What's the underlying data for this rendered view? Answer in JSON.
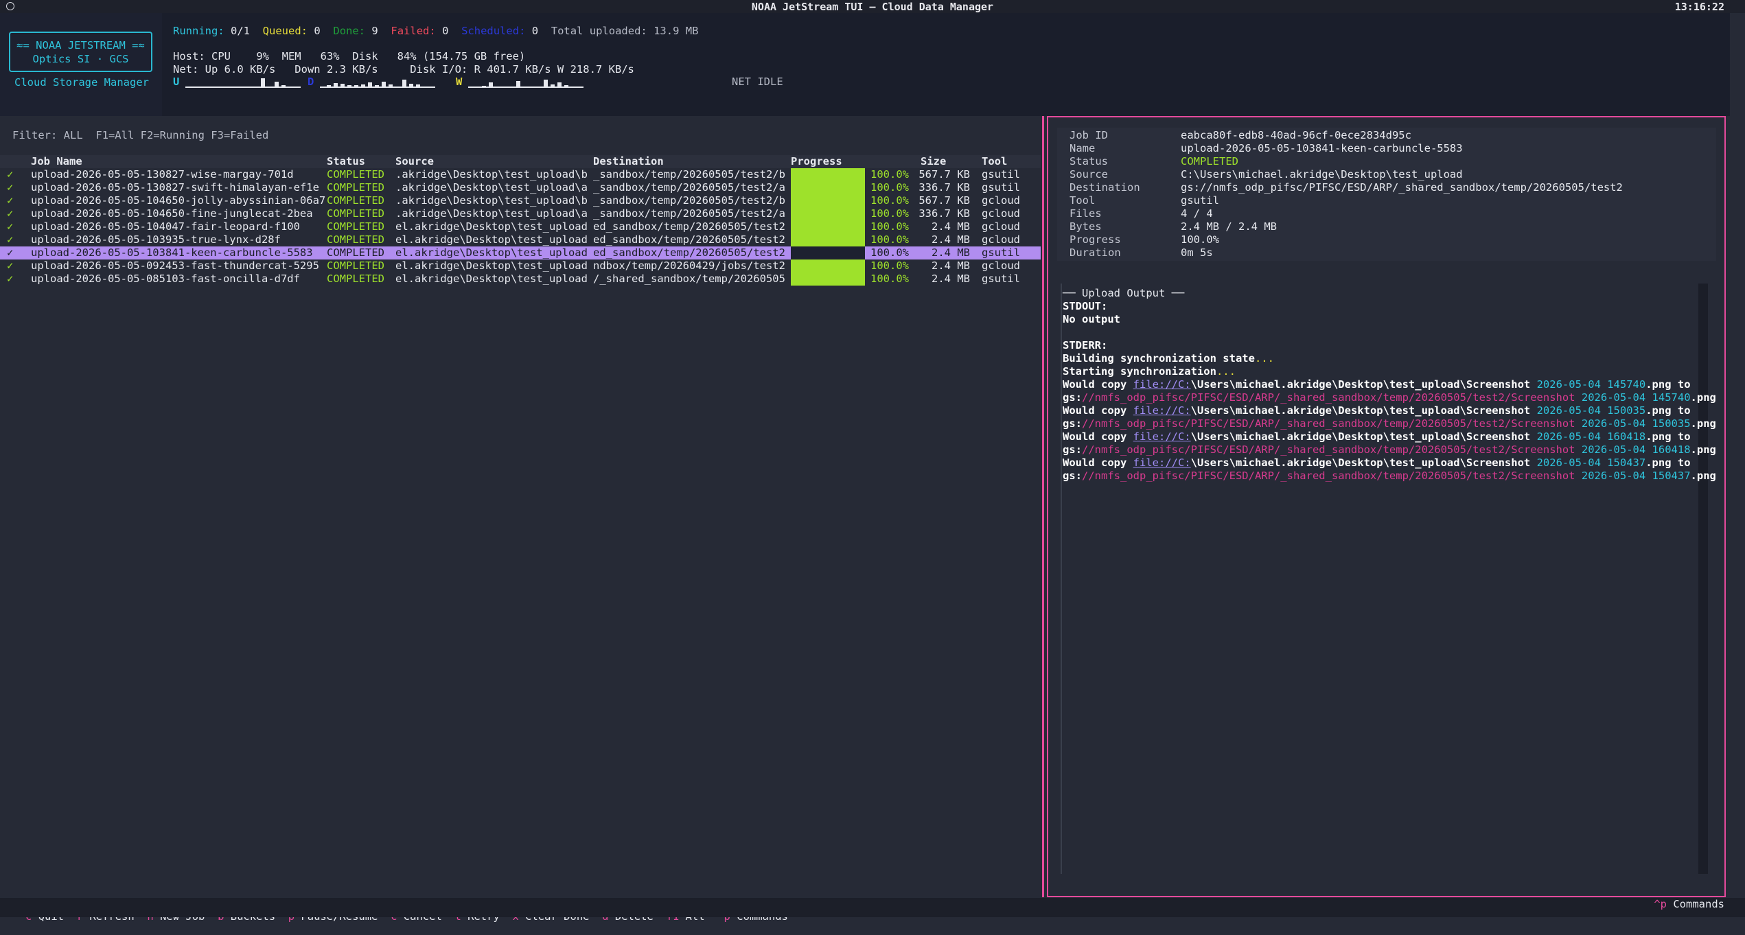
{
  "titlebar": {
    "title": "NOAA JetStream TUI — Cloud Data Manager",
    "clock": "13:16:22"
  },
  "logo": {
    "line1": "≈= NOAA JETSTREAM =≈",
    "line2": "Optics SI · GCS",
    "subtitle": "Cloud Storage Manager"
  },
  "stats": {
    "running_label": "Running:",
    "running_value": "0/1",
    "queued_label": "Queued:",
    "queued_value": "0",
    "done_label": "Done:",
    "done_value": "9",
    "failed_label": "Failed:",
    "failed_value": "0",
    "scheduled_label": "Scheduled:",
    "scheduled_value": "0",
    "total_uploaded": "Total uploaded: 13.9 MB",
    "host_line": "Host: CPU    9%  MEM   63%  Disk   84% (154.75 GB free)",
    "net_line": "Net: Up 6.0 KB/s   Down 2.3 KB/s     Disk I/O: R 401.7 KB/s W 218.7 KB/s",
    "spark_up_label": "U",
    "spark_down_label": "D",
    "spark_w_label": "W",
    "net_idle": "NET IDLE",
    "spark_up": [
      0,
      0,
      0,
      0,
      0,
      0,
      0,
      0,
      0,
      0,
      0,
      14,
      0,
      9,
      4,
      0,
      0
    ],
    "spark_down": [
      0,
      4,
      7,
      6,
      4,
      4,
      5,
      8,
      4,
      9,
      5,
      0,
      12,
      6,
      5,
      0,
      0
    ],
    "spark_w": [
      0,
      0,
      3,
      8,
      0,
      0,
      0,
      10,
      0,
      0,
      0,
      12,
      5,
      8,
      4,
      0,
      0
    ],
    "colors": {
      "cyan": "#2fc4dc",
      "blue": "#2b39d8",
      "yellow": "#e7dd3a"
    }
  },
  "filter": {
    "text": "Filter: ALL  F1=All F2=Running F3=Failed"
  },
  "table": {
    "headers": {
      "name": "Job Name",
      "status": "Status",
      "source": "Source",
      "destination": "Destination",
      "progress": "Progress",
      "size": "Size",
      "tool": "Tool"
    },
    "rows": [
      {
        "check": "✓",
        "name": "upload-2026-05-05-130827-wise-margay-701d",
        "status": "COMPLETED",
        "source": ".akridge\\Desktop\\test_upload\\b",
        "destination": "_sandbox/temp/20260505/test2/b",
        "progress": 1.0,
        "pct": "100.0%",
        "size": "567.7 KB",
        "tool": "gsutil"
      },
      {
        "check": "✓",
        "name": "upload-2026-05-05-130827-swift-himalayan-ef1e",
        "status": "COMPLETED",
        "source": ".akridge\\Desktop\\test_upload\\a",
        "destination": "_sandbox/temp/20260505/test2/a",
        "progress": 1.0,
        "pct": "100.0%",
        "size": "336.7 KB",
        "tool": "gsutil"
      },
      {
        "check": "✓",
        "name": "upload-2026-05-05-104650-jolly-abyssinian-06a7",
        "status": "COMPLETED",
        "source": ".akridge\\Desktop\\test_upload\\b",
        "destination": "_sandbox/temp/20260505/test2/b",
        "progress": 1.0,
        "pct": "100.0%",
        "size": "567.7 KB",
        "tool": "gcloud"
      },
      {
        "check": "✓",
        "name": "upload-2026-05-05-104650-fine-junglecat-2bea",
        "status": "COMPLETED",
        "source": ".akridge\\Desktop\\test_upload\\a",
        "destination": "_sandbox/temp/20260505/test2/a",
        "progress": 1.0,
        "pct": "100.0%",
        "size": "336.7 KB",
        "tool": "gcloud"
      },
      {
        "check": "✓",
        "name": "upload-2026-05-05-104047-fair-leopard-f100",
        "status": "COMPLETED",
        "source": "el.akridge\\Desktop\\test_upload",
        "destination": "ed_sandbox/temp/20260505/test2",
        "progress": 1.0,
        "pct": "100.0%",
        "size": "2.4 MB",
        "tool": "gcloud"
      },
      {
        "check": "✓",
        "name": "upload-2026-05-05-103935-true-lynx-d28f",
        "status": "COMPLETED",
        "source": "el.akridge\\Desktop\\test_upload",
        "destination": "ed_sandbox/temp/20260505/test2",
        "progress": 1.0,
        "pct": "100.0%",
        "size": "2.4 MB",
        "tool": "gcloud"
      },
      {
        "check": "✓",
        "name": "upload-2026-05-05-103841-keen-carbuncle-5583",
        "status": "COMPLETED",
        "source": "el.akridge\\Desktop\\test_upload",
        "destination": "ed_sandbox/temp/20260505/test2",
        "progress": 1.0,
        "pct": "100.0%",
        "size": "2.4 MB",
        "tool": "gsutil",
        "selected": true
      },
      {
        "check": "✓",
        "name": "upload-2026-05-05-092453-fast-thundercat-5295",
        "status": "COMPLETED",
        "source": "el.akridge\\Desktop\\test_upload",
        "destination": "ndbox/temp/20260429/jobs/test2",
        "progress": 1.0,
        "pct": "100.0%",
        "size": "2.4 MB",
        "tool": "gcloud"
      },
      {
        "check": "✓",
        "name": "upload-2026-05-05-085103-fast-oncilla-d7df",
        "status": "COMPLETED",
        "source": "el.akridge\\Desktop\\test_upload",
        "destination": "/_shared_sandbox/temp/20260505",
        "progress": 1.0,
        "pct": "100.0%",
        "size": "2.4 MB",
        "tool": "gsutil"
      }
    ]
  },
  "detail": {
    "fields": [
      {
        "key": "Job ID",
        "value": "eabca80f-edb8-40ad-96cf-0ece2834d95c"
      },
      {
        "key": "Name",
        "value": "upload-2026-05-05-103841-keen-carbuncle-5583"
      },
      {
        "key": "Status",
        "value": "COMPLETED",
        "status": true
      },
      {
        "key": "Source",
        "value": "C:\\Users\\michael.akridge\\Desktop\\test_upload"
      },
      {
        "key": "Destination",
        "value": "gs://nmfs_odp_pifsc/PIFSC/ESD/ARP/_shared_sandbox/temp/20260505/test2"
      },
      {
        "key": "Tool",
        "value": "gsutil"
      },
      {
        "key": "Files",
        "value": "4 / 4"
      },
      {
        "key": "Bytes",
        "value": "2.4 MB / 2.4 MB"
      },
      {
        "key": "Progress",
        "value": "100.0%"
      },
      {
        "key": "Duration",
        "value": "0m 5s"
      }
    ]
  },
  "output": {
    "heading": "── Upload Output ──",
    "stdout_label": "STDOUT:",
    "stdout_value": "No output",
    "stderr_label": "STDERR:",
    "line_build": "Building synchronization state",
    "line_start": "Starting synchronization",
    "dots": "...",
    "would_copy": "Would copy ",
    "file_prefix": "file://C:",
    "local_path": "\\Users\\michael.akridge\\Desktop\\test_upload\\Screenshot ",
    "to": " to",
    "gs_scheme": "gs:",
    "gs_path": "//nmfs_odp_pifsc/PIFSC/ESD/ARP/_shared_sandbox/temp/20260505/test2/Screenshot ",
    "ext": ".png",
    "files": [
      "2026-05-04 145740",
      "2026-05-04 150035",
      "2026-05-04 160418",
      "2026-05-04 150437"
    ]
  },
  "footer": {
    "items": [
      {
        "key": "^c",
        "label": "Quit"
      },
      {
        "key": "r",
        "label": "Refresh"
      },
      {
        "key": "n",
        "label": "New Job"
      },
      {
        "key": "b",
        "label": "Buckets"
      },
      {
        "key": "p",
        "label": "Pause/Resume"
      },
      {
        "key": "c",
        "label": "Cancel"
      },
      {
        "key": "t",
        "label": "Retry"
      },
      {
        "key": "x",
        "label": "Clear Done"
      },
      {
        "key": "d",
        "label": "Delete"
      },
      {
        "key": "f1",
        "label": "All"
      },
      {
        "key": "^p",
        "label": "Commands"
      }
    ],
    "right_key": "^p",
    "right_label": "Commands"
  }
}
